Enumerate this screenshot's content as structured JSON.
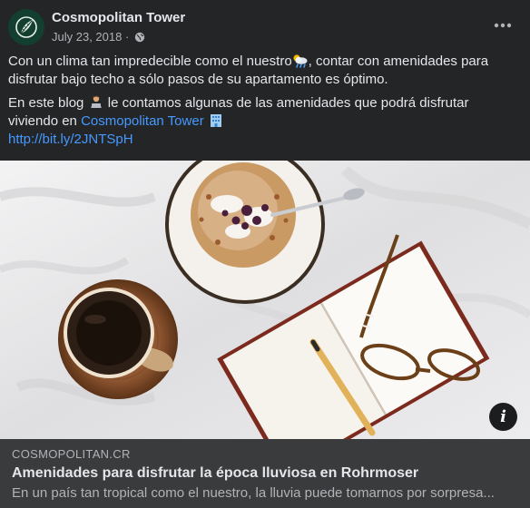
{
  "post": {
    "page_name": "Cosmopolitan Tower",
    "date": "July 23, 2018",
    "separator": "·",
    "audience_icon": "globe-icon",
    "more_icon": "more-options-icon",
    "text_line1_a": "Con un clima tan impredecible como el nuestro",
    "text_line1_b": ", contar con amenidades para disfrutar bajo techo a sólo pasos de su apartamento es óptimo.",
    "text_line2_a": "En este blog ",
    "text_line2_b": " le contamos algunas de las amenidades que podrá disfrutar viviendo en ",
    "page_link": "Cosmopolitan Tower",
    "url": "http://bit.ly/2JNTSpH"
  },
  "link_preview": {
    "domain": "COSMOPOLITAN.CR",
    "title": "Amenidades para disfrutar la época lluviosa en Rohrmoser",
    "description": "En un país tan tropical como el nuestro, la lluvia puede tomarnos por sorpresa...",
    "info_label": "i"
  },
  "colors": {
    "background": "#242526",
    "preview_background": "#3a3b3c",
    "link": "#4599ff",
    "primary_text": "#e4e6eb",
    "secondary_text": "#b0b3b8"
  }
}
